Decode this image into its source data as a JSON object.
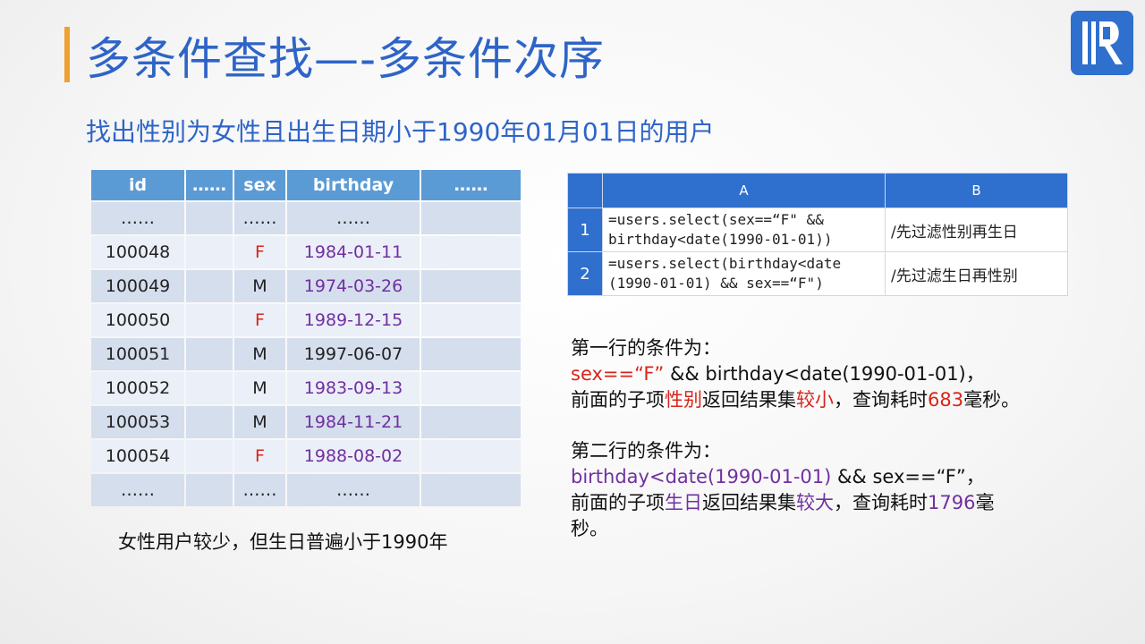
{
  "title": "多条件查找—-多条件次序",
  "subtitle": "找出性别为女性且出生日期小于1990年01月01日的用户",
  "colors": {
    "accent_bar": "#f0a030",
    "title_blue": "#2e64c8",
    "header_blue": "#5b9bd5",
    "red": "#d8251b",
    "purple": "#7030a0"
  },
  "logo": {
    "icon": "raqsoft-logo-icon"
  },
  "left_table": {
    "headers": [
      "id",
      "……",
      "sex",
      "birthday",
      "……"
    ],
    "rows": [
      [
        "……",
        "",
        "……",
        "……",
        ""
      ],
      [
        "100048",
        "",
        "F",
        "1984-01-11",
        ""
      ],
      [
        "100049",
        "",
        "M",
        "1974-03-26",
        ""
      ],
      [
        "100050",
        "",
        "F",
        "1989-12-15",
        ""
      ],
      [
        "100051",
        "",
        "M",
        "1997-06-07",
        ""
      ],
      [
        "100052",
        "",
        "M",
        "1983-09-13",
        ""
      ],
      [
        "100053",
        "",
        "M",
        "1984-11-21",
        ""
      ],
      [
        "100054",
        "",
        "F",
        "1988-08-02",
        ""
      ],
      [
        "……",
        "",
        "……",
        "……",
        ""
      ]
    ]
  },
  "left_note": "女性用户较少，但生日普遍小于1990年",
  "right_table": {
    "headers": [
      "A",
      "B"
    ],
    "rows": [
      {
        "num": "1",
        "code_line1": "=users.select(sex==“F\" &&",
        "code_line2": "birthday<date(1990-01-01))",
        "note": "/先过滤性别再生日"
      },
      {
        "num": "2",
        "code_line1": "=users.select(birthday<date",
        "code_line2": "(1990-01-01) && sex==“F\")",
        "note": "/先过滤生日再性别"
      }
    ]
  },
  "explain1": {
    "heading": "第一行的条件为：",
    "cond_red": "sex==“F” ",
    "cond_rest": " && birthday<date(1990-01-01)，",
    "p1": "前面的子项",
    "p1_red": "性别",
    "p2": "返回结果集",
    "p2_red": "较小",
    "p3": "，查询耗时",
    "time_red": "683",
    "p4": "毫秒。"
  },
  "explain2": {
    "heading": "第二行的条件为：",
    "cond_purple": "birthday<date(1990-01-01)",
    "cond_rest": " && sex==“F”，",
    "p1": "前面的子项",
    "p1_purple": "生日",
    "p2": "返回结果集",
    "p2_purple": "较大",
    "p3": "，查询耗时",
    "time_purple": "1796",
    "p4_line1": "毫",
    "p4_line2": "秒。"
  }
}
